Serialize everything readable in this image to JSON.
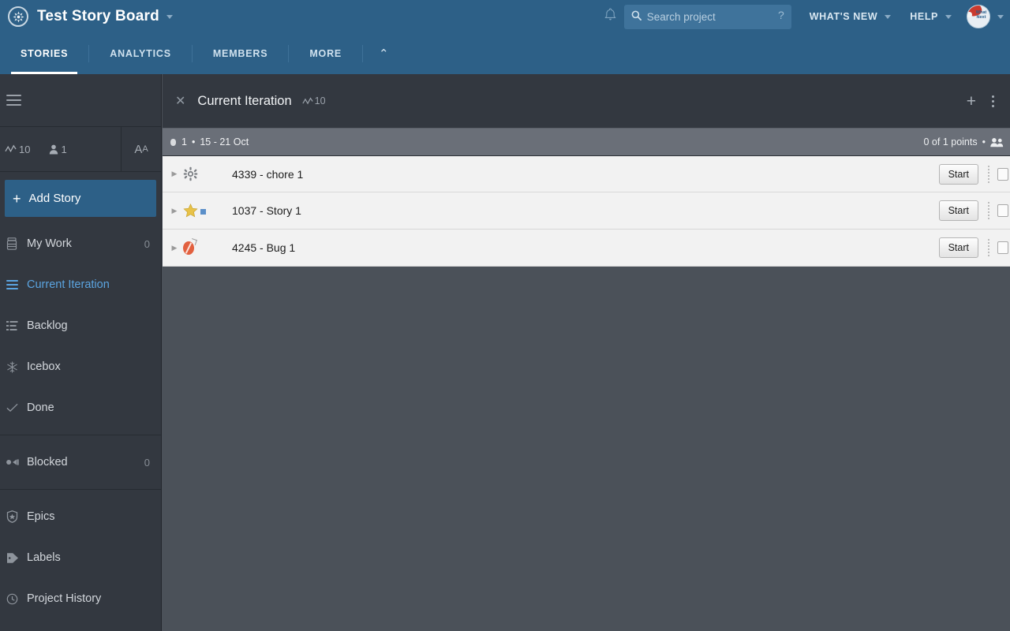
{
  "header": {
    "logo_icon": "pivotal-logo-icon",
    "project_title": "Test Story Board",
    "project_caret": "▾",
    "bell_icon": "notification-bell-icon",
    "search": {
      "icon": "search-icon",
      "placeholder": "Search project",
      "value": "",
      "help_hint": "?"
    },
    "menus": [
      {
        "label": "WHAT'S NEW",
        "caret": "▾"
      },
      {
        "label": "HELP",
        "caret": "▾"
      }
    ],
    "avatar": {
      "name": "avatar",
      "badge_text": "What Next",
      "caret": "▾"
    },
    "background_color": "#2d6087"
  },
  "nav": {
    "tabs": [
      {
        "label": "STORIES",
        "active": true
      },
      {
        "label": "ANALYTICS",
        "active": false
      },
      {
        "label": "MEMBERS",
        "active": false
      },
      {
        "label": "MORE",
        "active": false
      }
    ],
    "collapse_icon": "chevron-up-icon",
    "collapse_glyph": "⌃"
  },
  "sidebar": {
    "hamburger_icon": "hamburger-menu-icon",
    "stats": {
      "velocity_icon": "velocity-chart-icon",
      "velocity_value": "10",
      "members_icon": "person-icon",
      "members_value": "1",
      "text_size_icon": "text-size-icon",
      "text_size_label_big": "A",
      "text_size_label_small": "A"
    },
    "add_story": {
      "icon": "plus-icon",
      "glyph": "+",
      "label": "Add Story"
    },
    "items": [
      {
        "label": "My Work",
        "icon": "briefcase-icon",
        "count": "0",
        "active": false
      },
      {
        "label": "Current Iteration",
        "icon": "list-icon",
        "count": "",
        "active": true
      },
      {
        "label": "Backlog",
        "icon": "backlog-list-icon",
        "count": "",
        "active": false
      },
      {
        "label": "Icebox",
        "icon": "snowflake-icon",
        "glyph": "✲",
        "count": "",
        "active": false
      },
      {
        "label": "Done",
        "icon": "check-icon",
        "glyph": "✓",
        "count": "",
        "active": false
      }
    ],
    "items_secondary": [
      {
        "label": "Blocked",
        "icon": "blocked-icon",
        "count": "0",
        "active": false
      }
    ],
    "items_tertiary": [
      {
        "label": "Epics",
        "icon": "shield-star-icon",
        "glyph": "⬟",
        "count": "",
        "active": false
      },
      {
        "label": "Labels",
        "icon": "tag-icon",
        "glyph": "🏷",
        "count": "",
        "active": false
      },
      {
        "label": "Project History",
        "icon": "clock-icon",
        "glyph": "◷",
        "count": "",
        "active": false
      }
    ]
  },
  "panel": {
    "close_icon": "close-x-icon",
    "close_glyph": "✕",
    "title": "Current Iteration",
    "velocity_icon": "velocity-chart-icon",
    "velocity_value": "10",
    "add_icon": "plus-icon",
    "add_glyph": "+",
    "menu_icon": "kebab-menu-icon",
    "iteration": {
      "bullet_icon": "iteration-dot-icon",
      "number": "1",
      "separator": "•",
      "date_range": "15 - 21 Oct",
      "points_text": "0 of 1 points",
      "points_separator": "•",
      "people_icon": "people-icon"
    },
    "stories": [
      {
        "expand_icon": "chevron-right-icon",
        "expand_glyph": "▶",
        "type": "chore",
        "type_icon": "gear-icon",
        "type_glyph": "✿",
        "title": "4339 - chore 1",
        "estimate": "",
        "action_label": "Start",
        "drag_icon": "drag-handle-icon",
        "checkbox": "row-checkbox"
      },
      {
        "expand_icon": "chevron-right-icon",
        "expand_glyph": "▶",
        "type": "feature",
        "type_icon": "star-icon",
        "type_glyph": "★",
        "title": "1037 - Story 1",
        "estimate": "1",
        "action_label": "Start",
        "drag_icon": "drag-handle-icon",
        "checkbox": "row-checkbox"
      },
      {
        "expand_icon": "chevron-right-icon",
        "expand_glyph": "▶",
        "type": "bug",
        "type_icon": "bug-icon",
        "type_glyph": "",
        "title": "4245 - Bug 1",
        "estimate": "",
        "action_label": "Start",
        "drag_icon": "drag-handle-icon",
        "checkbox": "row-checkbox"
      }
    ]
  },
  "colors": {
    "header_blue": "#2d6087",
    "sidebar_dark": "#333840",
    "panel_gray": "#4b5159",
    "iteration_bar": "#6a6f78",
    "active_blue": "#5ba4e0",
    "row_white": "#f2f2f2"
  }
}
